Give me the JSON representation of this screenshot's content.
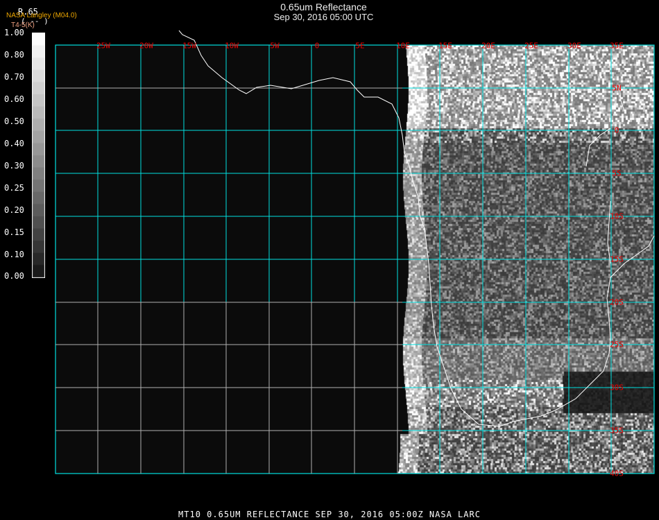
{
  "header": {
    "title": "0.65um Reflectance",
    "subtitle": "Sep 30, 2016 05:00 UTC"
  },
  "legend": {
    "channel": "R.65",
    "units": "( -- )",
    "credit": "NASA Langley (M04.0)",
    "secondary": "T4-5(K)",
    "ticks": [
      "1.00",
      "0.80",
      "0.70",
      "0.60",
      "0.50",
      "0.40",
      "0.30",
      "0.25",
      "0.20",
      "0.15",
      "0.10",
      "0.00"
    ],
    "tick_values": [
      1.0,
      0.8,
      0.7,
      0.6,
      0.5,
      0.4,
      0.3,
      0.25,
      0.2,
      0.15,
      0.1,
      0.0
    ]
  },
  "map": {
    "lon_labels": [
      "25W",
      "20W",
      "15W",
      "10W",
      "5W",
      "0",
      "5E",
      "10E",
      "15E",
      "20E",
      "25E",
      "30E",
      "35E"
    ],
    "lat_labels": [
      "5N",
      "0",
      "5S",
      "10S",
      "15S",
      "20S",
      "25S",
      "30S",
      "35S",
      "40S"
    ],
    "colors": {
      "grid": "#00e0e0",
      "grid_outside": "#b0b0b0",
      "labels": "#e00000",
      "coast": "#ffffff"
    }
  },
  "footer": "MT10  0.65UM REFLECTANCE   SEP 30, 2016 05:00Z   NASA LARC"
}
